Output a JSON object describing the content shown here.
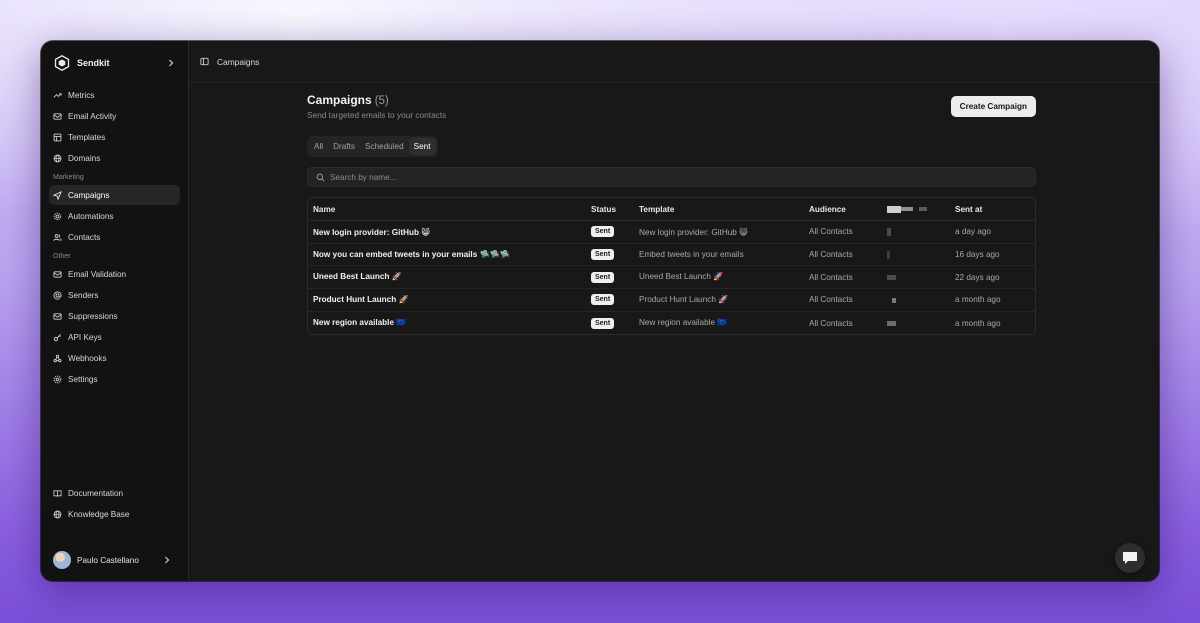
{
  "brand": {
    "name": "Sendkit"
  },
  "sidebar": {
    "top_items": [
      {
        "label": "Metrics",
        "icon": "trend-icon"
      },
      {
        "label": "Email Activity",
        "icon": "mail-icon"
      },
      {
        "label": "Templates",
        "icon": "template-icon"
      },
      {
        "label": "Domains",
        "icon": "globe-icon"
      }
    ],
    "marketing_label": "Marketing",
    "marketing_items": [
      {
        "label": "Campaigns",
        "icon": "send-icon",
        "active": true
      },
      {
        "label": "Automations",
        "icon": "gear-cog-icon"
      },
      {
        "label": "Contacts",
        "icon": "users-icon"
      }
    ],
    "other_label": "Other",
    "other_items": [
      {
        "label": "Email Validation",
        "icon": "mail-check-icon"
      },
      {
        "label": "Senders",
        "icon": "at-icon"
      },
      {
        "label": "Suppressions",
        "icon": "mail-x-icon"
      },
      {
        "label": "API Keys",
        "icon": "key-icon"
      },
      {
        "label": "Webhooks",
        "icon": "webhook-icon"
      },
      {
        "label": "Settings",
        "icon": "settings-icon"
      }
    ],
    "bottom_items": [
      {
        "label": "Documentation",
        "icon": "book-icon"
      },
      {
        "label": "Knowledge Base",
        "icon": "globe-icon"
      }
    ],
    "user_name": "Paulo Castellano"
  },
  "topbar": {
    "breadcrumb": "Campaigns"
  },
  "page": {
    "title": "Campaigns",
    "count": "(5)",
    "subtitle": "Send targeted emails to your contacts",
    "create_label": "Create Campaign"
  },
  "tabs": [
    {
      "label": "All",
      "active": false
    },
    {
      "label": "Drafts",
      "active": false
    },
    {
      "label": "Scheduled",
      "active": false
    },
    {
      "label": "Sent",
      "active": true
    }
  ],
  "search": {
    "placeholder": "Search by name..."
  },
  "table": {
    "headers": {
      "name": "Name",
      "status": "Status",
      "template": "Template",
      "audience": "Audience",
      "sent_at": "Sent at"
    },
    "rows": [
      {
        "name": "New login provider: GitHub 😸",
        "status": "Sent",
        "template": "New login provider: GitHub 😸",
        "audience": "All Contacts",
        "sent_at": "a day ago"
      },
      {
        "name": "Now you can embed tweets in your emails 🛸🛸🛸",
        "status": "Sent",
        "template": "Embed tweets in your emails",
        "audience": "All Contacts",
        "sent_at": "16 days ago"
      },
      {
        "name": "Uneed Best Launch 🚀",
        "status": "Sent",
        "template": "Uneed Best Launch 🚀",
        "audience": "All Contacts",
        "sent_at": "22 days ago"
      },
      {
        "name": "Product Hunt Launch 🚀",
        "status": "Sent",
        "template": "Product Hunt Launch 🚀",
        "audience": "All Contacts",
        "sent_at": "a month ago"
      },
      {
        "name": "New region available 🇪🇺",
        "status": "Sent",
        "template": "New region available 🇪🇺",
        "audience": "All Contacts",
        "sent_at": "a month ago"
      }
    ]
  },
  "colors": {
    "window_bg": "#121212",
    "main_bg": "#181818",
    "active_item": "#262626",
    "button_bg": "#ececec"
  }
}
